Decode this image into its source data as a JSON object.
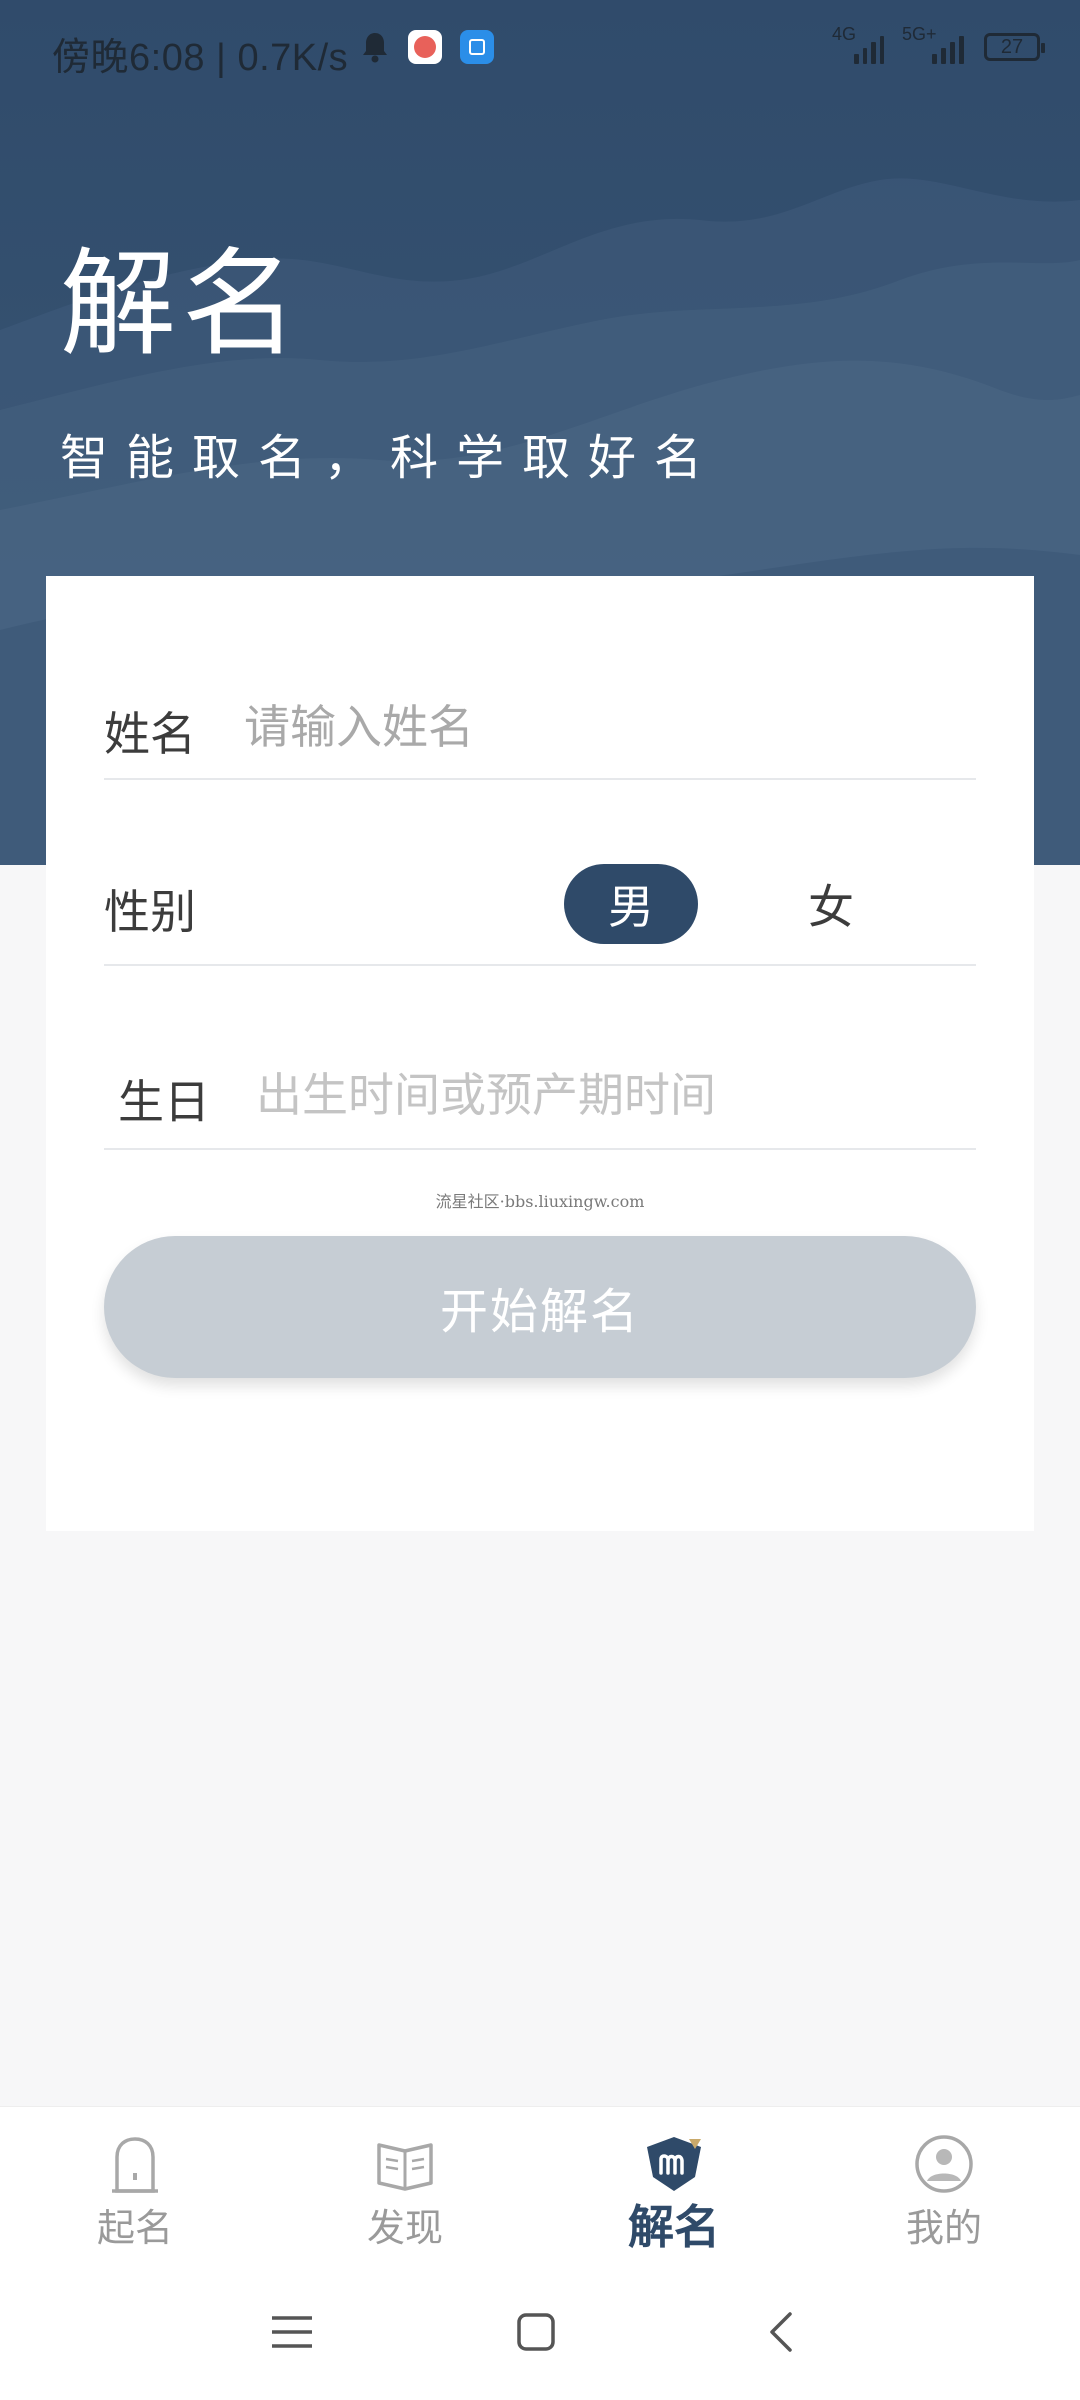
{
  "status_bar": {
    "time": "傍晚6:08 | 0.7K/s",
    "signal1_label": "4G",
    "signal2_label": "5G+",
    "battery": "27"
  },
  "header": {
    "title": "解名",
    "subtitle": "智能取名，科学取好名"
  },
  "form": {
    "name_label": "姓名",
    "name_placeholder": "请输入姓名",
    "gender_label": "性别",
    "gender_male": "男",
    "gender_female": "女",
    "selected_gender": "男",
    "birthday_label": "生日",
    "birthday_placeholder": "出生时间或预产期时间",
    "watermark": "流星社区·bbs.liuxingw.com",
    "submit_label": "开始解名"
  },
  "tabs": [
    {
      "label": "起名",
      "icon": "door-icon",
      "active": false
    },
    {
      "label": "发现",
      "icon": "book-icon",
      "active": false
    },
    {
      "label": "解名",
      "icon": "logo-m-icon",
      "active": true
    },
    {
      "label": "我的",
      "icon": "profile-icon",
      "active": false
    }
  ],
  "colors": {
    "primary": "#2f4a69",
    "header_bg": "#34506f",
    "button_disabled": "#c6cdd4",
    "page_bg": "#f7f7f8"
  }
}
